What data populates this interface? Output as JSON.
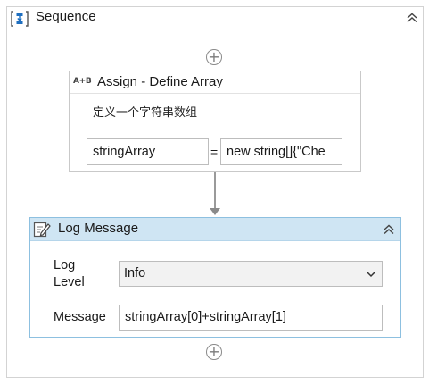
{
  "sequence": {
    "title": "Sequence",
    "icon": "sequence-icon",
    "add_top_glyph": "+",
    "add_bottom_glyph": "+"
  },
  "assign": {
    "icon_text": "A+B",
    "title": "Assign - Define Array",
    "description": "定义一个字符串数组",
    "to_value": "stringArray",
    "equals": "=",
    "value": "new string[]{\"Che"
  },
  "log_message": {
    "title": "Log Message",
    "icon": "log-message-icon",
    "level_label": "Log Level",
    "level_value": "Info",
    "message_label": "Message",
    "message_value": "stringArray[0]+stringArray[1]"
  },
  "colors": {
    "log_header_bg": "#cfe5f3",
    "log_border": "#8dc0e0",
    "sequence_icon_blue": "#1f6fc0"
  }
}
